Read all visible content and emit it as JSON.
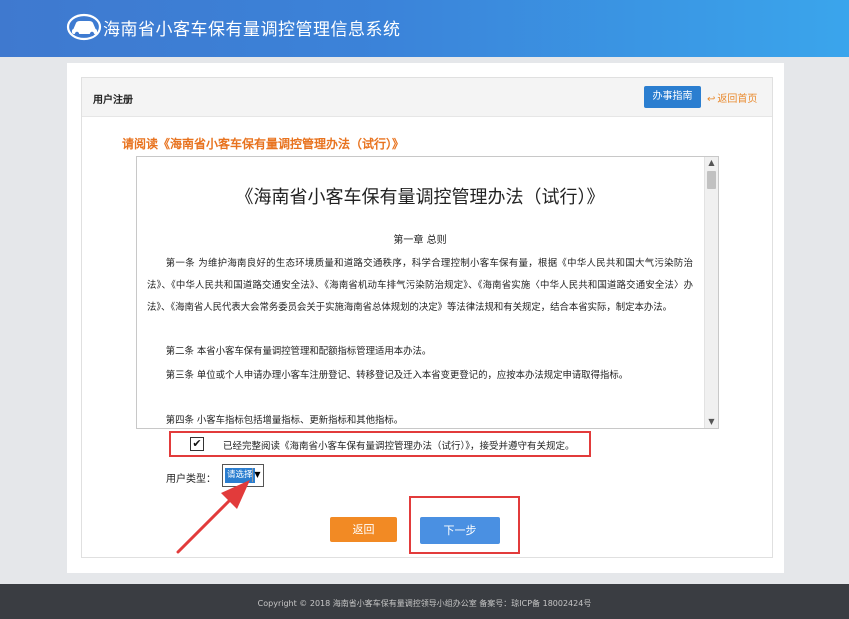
{
  "header": {
    "title": "海南省小客车保有量调控管理信息系统",
    "logo_icon": "car-logo-icon",
    "gradient_start": "#3f79cf",
    "gradient_end": "#3aa5ec"
  },
  "panel": {
    "title": "用户注册",
    "guide_label": "办事指南",
    "home_label": "返回首页",
    "home_icon": "return-arrow-icon"
  },
  "notice": "请阅读《海南省小客车保有量调控管理办法（试行）》",
  "document": {
    "title": "《海南省小客车保有量调控管理办法（试行）》",
    "chapter": "第一章  总则",
    "paragraphs": [
      "第一条  为维护海南良好的生态环境质量和道路交通秩序，科学合理控制小客车保有量，根据《中华人民共和国大气污染防治法》、《中华人民共和国道路交通安全法》、《海南省机动车排气污染防治规定》、《海南省实施〈中华人民共和国道路交通安全法〉办法》、《海南省人民代表大会常务委员会关于实施海南省总体规划的决定》等法律法规和有关规定，结合本省实际，制定本办法。",
      "第二条  本省小客车保有量调控管理和配额指标管理适用本办法。",
      "第三条  单位或个人申请办理小客车注册登记、转移登记及迁入本省变更登记的，应按本办法规定申请取得指标。",
      "第四条  小客车指标包括增量指标、更新指标和其他指标。"
    ]
  },
  "agreement": {
    "checked": true,
    "check_mark": "✔",
    "text": "已经完整阅读《海南省小客车保有量调控管理办法（试行）》，接受并遵守有关规定。"
  },
  "user_type": {
    "label": "用户类型：",
    "selected": "请选择"
  },
  "buttons": {
    "back": "返回",
    "next": "下一步",
    "back_color": "#f28a24",
    "next_color": "#4a90e2"
  },
  "annotation_color": "#e23b3b",
  "footer": {
    "text": "Copyright © 2018   海南省小客车保有量调控领导小组办公室    备案号：琼ICP备 18002424号"
  }
}
